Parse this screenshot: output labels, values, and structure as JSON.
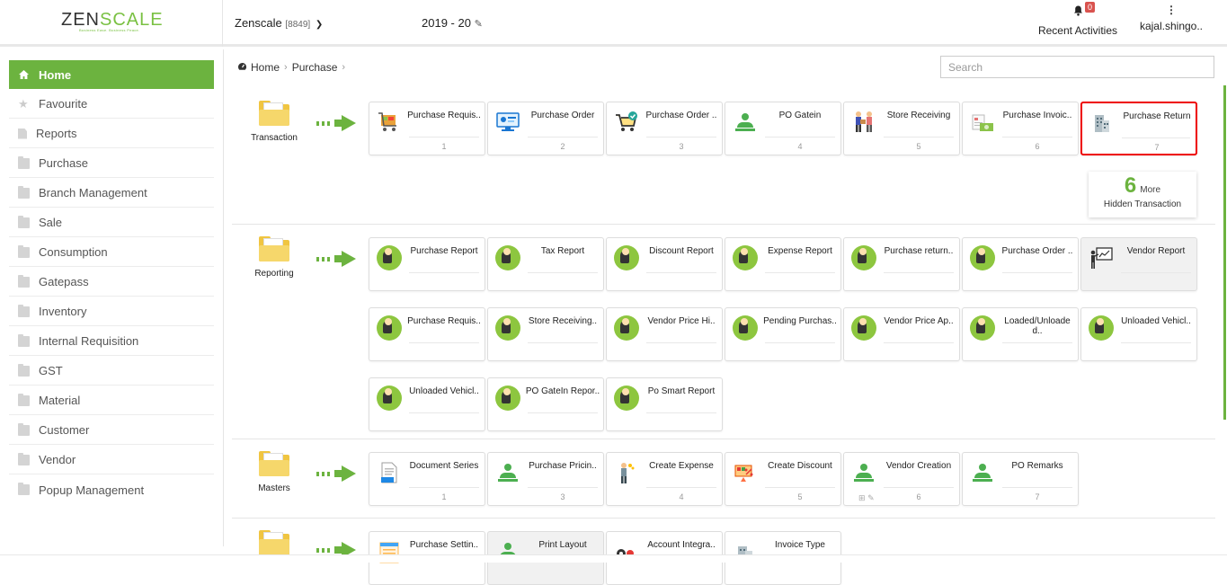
{
  "header": {
    "logo_main": "ZEN",
    "logo_accent": "SCALE",
    "logo_tagline": "Business Ease. Business Peace.",
    "company_name": "Zenscale",
    "company_code": "[8849]",
    "financial_year": "2019 - 20",
    "recent_activities_label": "Recent Activities",
    "notification_count": "0",
    "username": "kajal.shingo.."
  },
  "sidebar": {
    "items": [
      {
        "label": "Home"
      },
      {
        "label": "Favourite"
      },
      {
        "label": "Reports"
      },
      {
        "label": "Purchase"
      },
      {
        "label": "Branch Management"
      },
      {
        "label": "Sale"
      },
      {
        "label": "Consumption"
      },
      {
        "label": "Gatepass"
      },
      {
        "label": "Inventory"
      },
      {
        "label": "Internal Requisition"
      },
      {
        "label": "GST"
      },
      {
        "label": "Material"
      },
      {
        "label": "Customer"
      },
      {
        "label": "Vendor"
      },
      {
        "label": "Popup Management"
      }
    ]
  },
  "breadcrumb": {
    "home": "Home",
    "current": "Purchase"
  },
  "search": {
    "placeholder": "Search"
  },
  "sections": {
    "transaction": {
      "label": "Transaction",
      "tiles": [
        {
          "label": "Purchase Requis..",
          "num": "1"
        },
        {
          "label": "Purchase Order",
          "num": "2"
        },
        {
          "label": "Purchase Order ..",
          "num": "3"
        },
        {
          "label": "PO Gatein",
          "num": "4"
        },
        {
          "label": "Store Receiving",
          "num": "5"
        },
        {
          "label": "Purchase Invoic..",
          "num": "6"
        },
        {
          "label": "Purchase Return",
          "num": "7"
        }
      ],
      "more_count": "6",
      "more_word": "More",
      "more_label": "Hidden Transaction"
    },
    "reporting": {
      "label": "Reporting",
      "tiles": [
        {
          "label": "Purchase Report"
        },
        {
          "label": "Tax Report"
        },
        {
          "label": "Discount Report"
        },
        {
          "label": "Expense Report"
        },
        {
          "label": "Purchase return.."
        },
        {
          "label": "Purchase Order .."
        },
        {
          "label": "Vendor Report"
        },
        {
          "label": "Purchase Requis.."
        },
        {
          "label": "Store Receiving.."
        },
        {
          "label": "Vendor Price Hi.."
        },
        {
          "label": "Pending Purchas.."
        },
        {
          "label": "Vendor Price Ap.."
        },
        {
          "label": "Loaded/Unloade d.."
        },
        {
          "label": "Unloaded Vehicl.."
        },
        {
          "label": "Unloaded Vehicl.."
        },
        {
          "label": "PO GateIn Repor.."
        },
        {
          "label": "Po Smart Report"
        }
      ]
    },
    "masters": {
      "label": "Masters",
      "tiles": [
        {
          "label": "Document Series",
          "num": "1"
        },
        {
          "label": "Purchase Pricin..",
          "num": "3"
        },
        {
          "label": "Create Expense",
          "num": "4"
        },
        {
          "label": "Create Discount",
          "num": "5"
        },
        {
          "label": "Vendor Creation",
          "num": "6"
        },
        {
          "label": "PO Remarks",
          "num": "7"
        }
      ]
    },
    "settings": {
      "tiles": [
        {
          "label": "Purchase Settin.."
        },
        {
          "label": "Print Layout"
        },
        {
          "label": "Account Integra.."
        },
        {
          "label": "Invoice Type"
        }
      ]
    }
  },
  "colors": {
    "accent": "#6cb33f",
    "selected_border": "#e00000",
    "folder": "#f0c541"
  }
}
